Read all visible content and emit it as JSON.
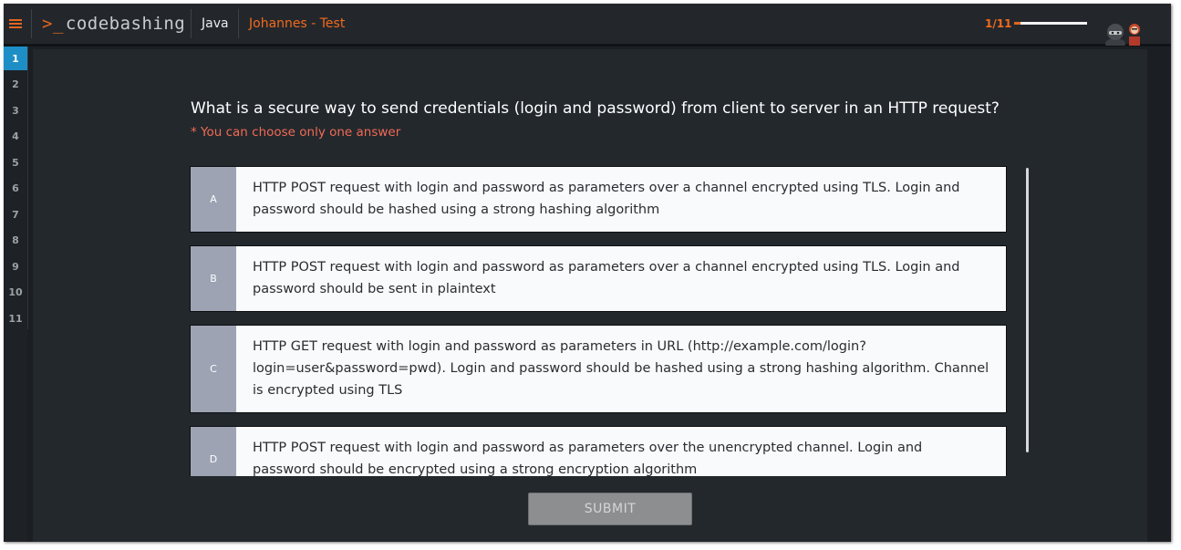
{
  "header": {
    "menu_icon": "hamburger-icon",
    "logo_prompt": ">_",
    "logo_text": "codebashing",
    "language": "Java",
    "course": "Johannes - Test",
    "progress_text": "1/11",
    "progress_fraction": 0.09,
    "avatar_icon": "characters-avatar-icon"
  },
  "sidebar": {
    "items": [
      "1",
      "2",
      "3",
      "4",
      "5",
      "6",
      "7",
      "8",
      "9",
      "10",
      "11"
    ],
    "active_index": 0
  },
  "quiz": {
    "question": "What is a secure way to send credentials (login and password) from client to server in an HTTP request?",
    "hint": "* You can choose only one answer",
    "answers": [
      {
        "letter": "A",
        "lines": [
          "HTTP POST request with login and password as parameters over a channel encrypted using TLS. Login and",
          "password should be hashed using a strong hashing algorithm"
        ]
      },
      {
        "letter": "B",
        "lines": [
          "HTTP POST request with login and password as parameters over a channel encrypted using TLS. Login and",
          "password should be sent in plaintext"
        ]
      },
      {
        "letter": "C",
        "lines": [
          "HTTP GET request with login and password as parameters in URL (http://example.com/login?",
          "login=user&password=pwd). Login and password should be hashed using a strong hashing algorithm. Channel",
          "is encrypted using TLS"
        ]
      },
      {
        "letter": "D",
        "lines": [
          "HTTP POST request with login and password as parameters over the unencrypted channel. Login and",
          "password should be encrypted using a strong encryption algorithm"
        ]
      }
    ],
    "submit_label": "SUBMIT"
  },
  "colors": {
    "accent": "#e0661e",
    "active_item": "#1e8fc6",
    "answer_letter_bg": "#9ea3b3",
    "submit_disabled": "#8d8e90"
  }
}
